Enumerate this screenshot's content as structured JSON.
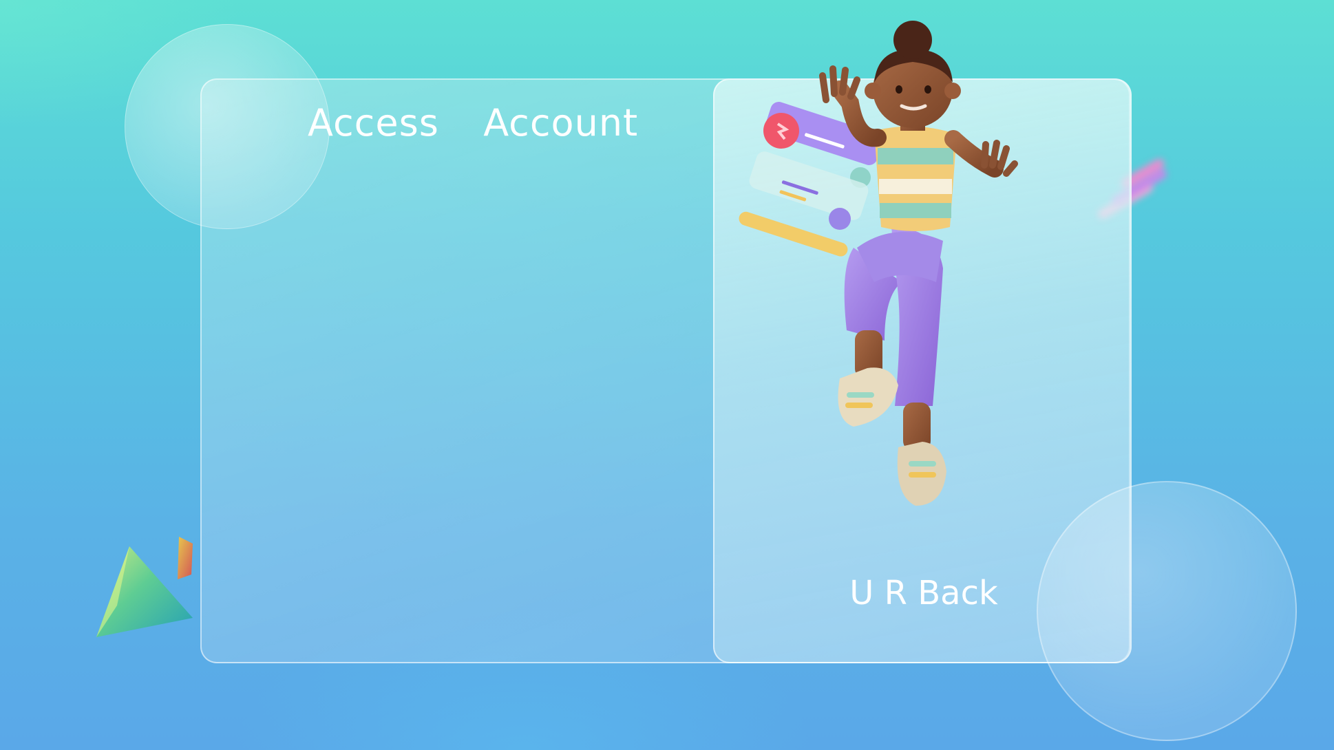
{
  "form": {
    "title": "Access  Account"
  },
  "welcome_panel": {
    "message": "U R Back",
    "illustration": "waving-person-3d-icon"
  },
  "decorations": {
    "shapes": [
      "bubble-top",
      "bubble-bottom",
      "cone-shape",
      "stripes-shape"
    ]
  },
  "colors": {
    "background_top": "#5ddfd4",
    "background_bottom": "#5aa8e8",
    "text": "#ffffff"
  }
}
